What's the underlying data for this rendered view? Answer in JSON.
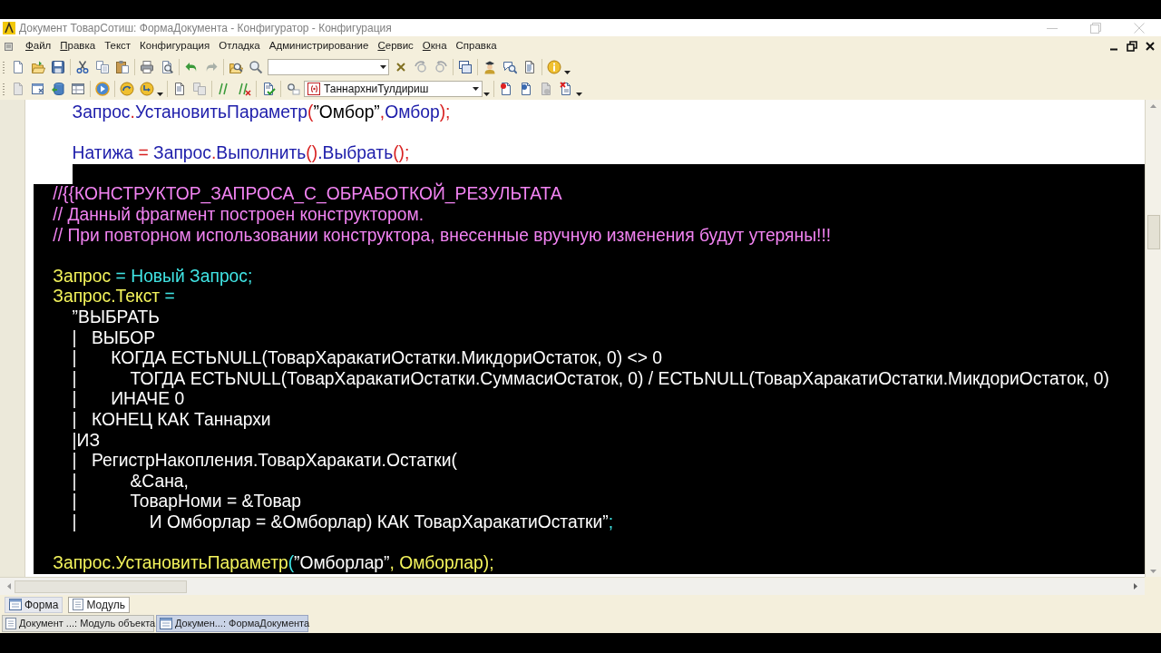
{
  "window": {
    "title": "Документ ТоварСотиш: ФормаДокумента - Конфигуратор - Конфигурация"
  },
  "menu_bar": {
    "items": [
      {
        "label": "Файл",
        "accelerator_underlined": true
      },
      {
        "label": "Правка",
        "accelerator_underlined": true
      },
      {
        "label": "Текст",
        "accelerator_underlined": false
      },
      {
        "label": "Конфигурация",
        "accelerator_underlined": false
      },
      {
        "label": "Отладка",
        "accelerator_underlined": false
      },
      {
        "label": "Администрирование",
        "accelerator_underlined": false
      },
      {
        "label": "Сервис",
        "accelerator_underlined": true
      },
      {
        "label": "Окна",
        "accelerator_underlined": true
      },
      {
        "label": "Справка",
        "accelerator_underlined": false
      }
    ]
  },
  "toolbar": {
    "procedure_field": {
      "value": "ТаннархниТулдириш"
    }
  },
  "editor": {
    "lines": [
      {
        "selected": false,
        "segments": [
          {
            "kind": "ident",
            "text": "\t\tЗапрос"
          },
          {
            "kind": "op",
            "text": "."
          },
          {
            "kind": "ident",
            "text": "УстановитьПараметр"
          },
          {
            "kind": "op",
            "text": "("
          },
          {
            "kind": "string",
            "text": "”Омбор”"
          },
          {
            "kind": "op",
            "text": ","
          },
          {
            "kind": "ident",
            "text": "Омбор"
          },
          {
            "kind": "op",
            "text": ");"
          }
        ]
      },
      {
        "selected": false
      },
      {
        "selected": false,
        "segments": [
          {
            "kind": "ident",
            "text": "\t\tНатижа"
          },
          {
            "kind": "op",
            "text": " = "
          },
          {
            "kind": "ident",
            "text": "Запрос"
          },
          {
            "kind": "op",
            "text": "."
          },
          {
            "kind": "ident",
            "text": "Выполнить"
          },
          {
            "kind": "op",
            "text": "()"
          },
          {
            "kind": "ident",
            "text": ".Выбрать"
          },
          {
            "kind": "op",
            "text": "();"
          }
        ]
      },
      {
        "selected": true
      },
      {
        "selected": true,
        "segments": [
          {
            "kind": "comment",
            "text": "\t//{{КОНСТРУКТОР_ЗАПРОСА_С_ОБРАБОТКОЙ_РЕЗУЛЬТАТА"
          }
        ]
      },
      {
        "selected": true,
        "segments": [
          {
            "kind": "comment",
            "text": "\t// Данный фрагмент построен конструктором."
          }
        ]
      },
      {
        "selected": true,
        "segments": [
          {
            "kind": "comment",
            "text": "\t// При повторном использовании конструктора, внесенные вручную изменения будут утеряны!!!"
          }
        ]
      },
      {
        "selected": true
      },
      {
        "selected": true,
        "segments": [
          {
            "kind": "ident",
            "text": "\tЗапрос"
          },
          {
            "kind": "op",
            "text": " = "
          },
          {
            "kind": "keyword",
            "text": "Новый Запрос"
          },
          {
            "kind": "op",
            "text": ";"
          }
        ]
      },
      {
        "selected": true,
        "segments": [
          {
            "kind": "ident",
            "text": "\tЗапрос.Текст"
          },
          {
            "kind": "op",
            "text": " ="
          }
        ]
      },
      {
        "selected": true,
        "segments": [
          {
            "kind": "string",
            "text": "\t\t”ВЫБРАТЬ"
          }
        ]
      },
      {
        "selected": true,
        "segments": [
          {
            "kind": "string",
            "text": "\t\t|\tВЫБОР"
          }
        ]
      },
      {
        "selected": true,
        "segments": [
          {
            "kind": "string",
            "text": "\t\t|\t\tКОГДА ЕСТЬNULL(ТоварХаракатиОстатки.МикдориОстаток, 0) <> 0"
          }
        ]
      },
      {
        "selected": true,
        "segments": [
          {
            "kind": "string",
            "text": "\t\t|\t\t\tТОГДА ЕСТЬNULL(ТоварХаракатиОстатки.СуммасиОстаток, 0) / ЕСТЬNULL(ТоварХаракатиОстатки.МикдориОстаток, 0)"
          }
        ]
      },
      {
        "selected": true,
        "segments": [
          {
            "kind": "string",
            "text": "\t\t|\t\tИНАЧЕ 0"
          }
        ]
      },
      {
        "selected": true,
        "segments": [
          {
            "kind": "string",
            "text": "\t\t|\tКОНЕЦ КАК Таннархи"
          }
        ]
      },
      {
        "selected": true,
        "segments": [
          {
            "kind": "string",
            "text": "\t\t|ИЗ"
          }
        ]
      },
      {
        "selected": true,
        "segments": [
          {
            "kind": "string",
            "text": "\t\t|\tРегистрНакопления.ТоварХаракати.Остатки("
          }
        ]
      },
      {
        "selected": true,
        "segments": [
          {
            "kind": "string",
            "text": "\t\t|\t\t\t&Сана,"
          }
        ]
      },
      {
        "selected": true,
        "segments": [
          {
            "kind": "string",
            "text": "\t\t|\t\t\tТоварНоми = &Товар"
          }
        ]
      },
      {
        "selected": true,
        "segments": [
          {
            "kind": "string",
            "text": "\t\t|\t\t\t\tИ Омборлар = &Омборлар) КАК ТоварХаракатиОстатки”"
          },
          {
            "kind": "op",
            "text": ";"
          }
        ]
      },
      {
        "selected": true
      },
      {
        "selected": true,
        "segments": [
          {
            "kind": "ident",
            "text": "\tЗапрос.УстановитьПараметр"
          },
          {
            "kind": "op",
            "text": "("
          },
          {
            "kind": "string",
            "text": "”Омборлар”"
          },
          {
            "kind": "ident",
            "text": ", Омборлар);"
          }
        ]
      }
    ]
  },
  "bottom_tabs": [
    {
      "label": "Форма",
      "kind": "form",
      "selected": false
    },
    {
      "label": "Модуль",
      "kind": "module",
      "selected": true
    }
  ],
  "open_windows": [
    {
      "label": "Документ ...: Модуль объекта",
      "kind": "module",
      "selected": false
    },
    {
      "label": "Докумен...: ФормаДокумента",
      "kind": "form",
      "selected": true
    }
  ]
}
